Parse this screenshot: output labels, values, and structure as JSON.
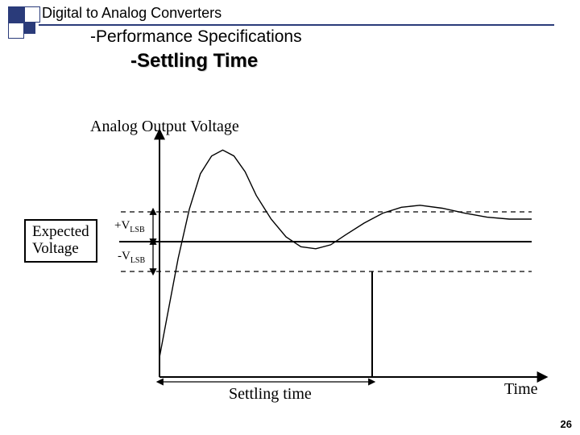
{
  "header": {
    "title": "Digital to Analog Converters",
    "subtitle": "-Performance Specifications",
    "subtitle2": "-Settling Time"
  },
  "labels": {
    "y_axis": "Analog Output Voltage",
    "x_axis": "Time",
    "settling_time": "Settling time",
    "expected_line1": "Expected",
    "expected_line2": "Voltage",
    "plus_vlsb_prefix": "+V",
    "plus_vlsb_sub": "LSB",
    "minus_vlsb_prefix": "-V",
    "minus_vlsb_sub": "LSB"
  },
  "page": {
    "number": "26"
  },
  "chart_data": {
    "type": "line",
    "title": "DAC settling time – damped step response",
    "xlabel": "Time",
    "ylabel": "Analog Output Voltage",
    "expected_voltage": 0,
    "tolerance_band": {
      "upper": "+V_LSB",
      "lower": "-V_LSB",
      "half_width": 1
    },
    "settling_time_x": 0.57,
    "x": [
      0.0,
      0.02,
      0.05,
      0.08,
      0.11,
      0.14,
      0.17,
      0.2,
      0.23,
      0.26,
      0.3,
      0.34,
      0.38,
      0.42,
      0.46,
      0.5,
      0.55,
      0.6,
      0.65,
      0.7,
      0.76,
      0.82,
      0.88,
      0.94,
      1.0
    ],
    "y": [
      -7.0,
      -5.0,
      -2.0,
      0.5,
      2.3,
      3.2,
      3.5,
      3.2,
      2.4,
      1.2,
      0.0,
      -0.9,
      -1.4,
      -1.5,
      -1.3,
      -0.8,
      -0.2,
      0.3,
      0.6,
      0.7,
      0.55,
      0.3,
      0.1,
      0.0,
      0.0
    ],
    "ylim": [
      -8,
      4
    ]
  }
}
